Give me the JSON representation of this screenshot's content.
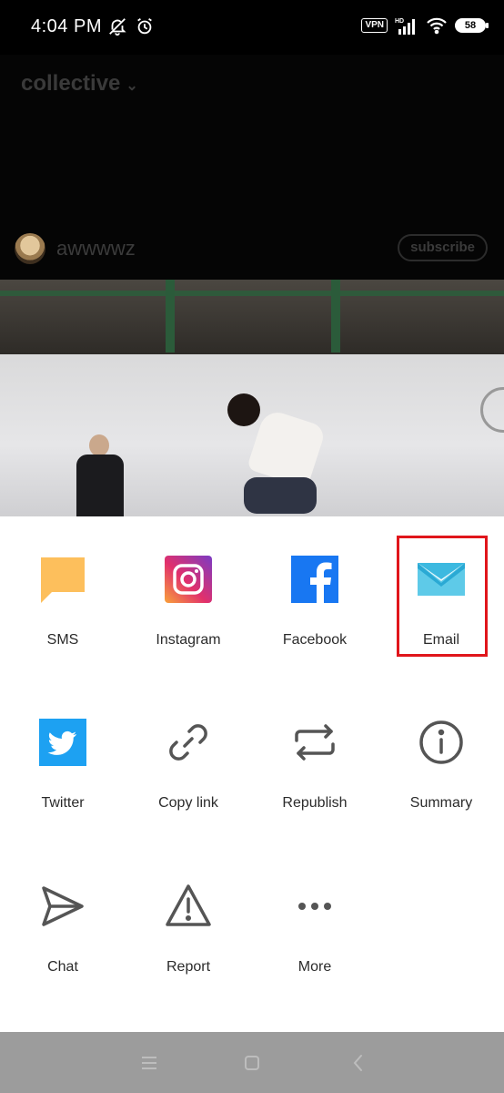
{
  "status_bar": {
    "time": "4:04 PM",
    "left_icons": [
      "mute-bell-icon",
      "alarm-icon"
    ],
    "vpn": "VPN",
    "hd": "HD",
    "battery": "58"
  },
  "post": {
    "blog_name": "collective",
    "author": "awwwwz",
    "subscribe_label": "subscribe"
  },
  "share": {
    "items": [
      {
        "label": "SMS",
        "icon": "sms-icon"
      },
      {
        "label": "Instagram",
        "icon": "instagram-icon"
      },
      {
        "label": "Facebook",
        "icon": "facebook-icon"
      },
      {
        "label": "Email",
        "icon": "email-icon"
      },
      {
        "label": "Twitter",
        "icon": "twitter-icon"
      },
      {
        "label": "Copy link",
        "icon": "link-icon"
      },
      {
        "label": "Republish",
        "icon": "republish-icon"
      },
      {
        "label": "Summary",
        "icon": "info-icon"
      },
      {
        "label": "Chat",
        "icon": "send-icon"
      },
      {
        "label": "Report",
        "icon": "warning-icon"
      },
      {
        "label": "More",
        "icon": "more-dots-icon"
      }
    ],
    "highlighted": "Email",
    "colors": {
      "sms": "#fdbf5c",
      "facebook": "#1877f2",
      "email": "#3cb9e0",
      "twitter": "#1da1f2",
      "highlight": "#e0151b",
      "icon_stroke": "#555555"
    }
  },
  "nav_bar": {
    "buttons": [
      "menu-icon",
      "home-icon",
      "back-icon"
    ]
  }
}
